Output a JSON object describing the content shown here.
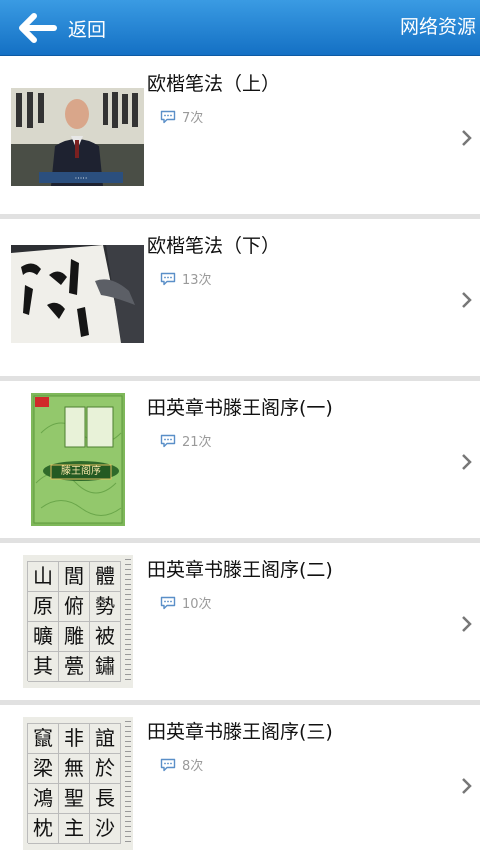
{
  "header": {
    "back_label": "返回",
    "resource_label": "网络资源"
  },
  "items": [
    {
      "title": "欧楷笔法（上）",
      "count": "7次",
      "thumb": "video-lecture"
    },
    {
      "title": "欧楷笔法（下）",
      "count": "13次",
      "thumb": "brush-writing"
    },
    {
      "title": "田英章书滕王阁序(一)",
      "count": "21次",
      "thumb": "book-cover"
    },
    {
      "title": "田英章书滕王阁序(二)",
      "count": "10次",
      "thumb": "calligraphy-grid"
    },
    {
      "title": "田英章书滕王阁序(三)",
      "count": "8次",
      "thumb": "calligraphy-grid"
    }
  ],
  "thumb_text": {
    "book_title": "滕王阁序",
    "grid2": [
      "山",
      "閭",
      "體",
      "原",
      "俯",
      "勢",
      "曠",
      "雕",
      "被",
      "其",
      "甍",
      "鏽"
    ],
    "grid3": [
      "竄",
      "非",
      "誼",
      "梁",
      "無",
      "於",
      "鴻",
      "聖",
      "長",
      "枕",
      "主",
      "沙"
    ]
  },
  "colors": {
    "topbar": "#1e82d2",
    "separator": "#e1e1e1",
    "count_text": "#9a9a9a"
  }
}
